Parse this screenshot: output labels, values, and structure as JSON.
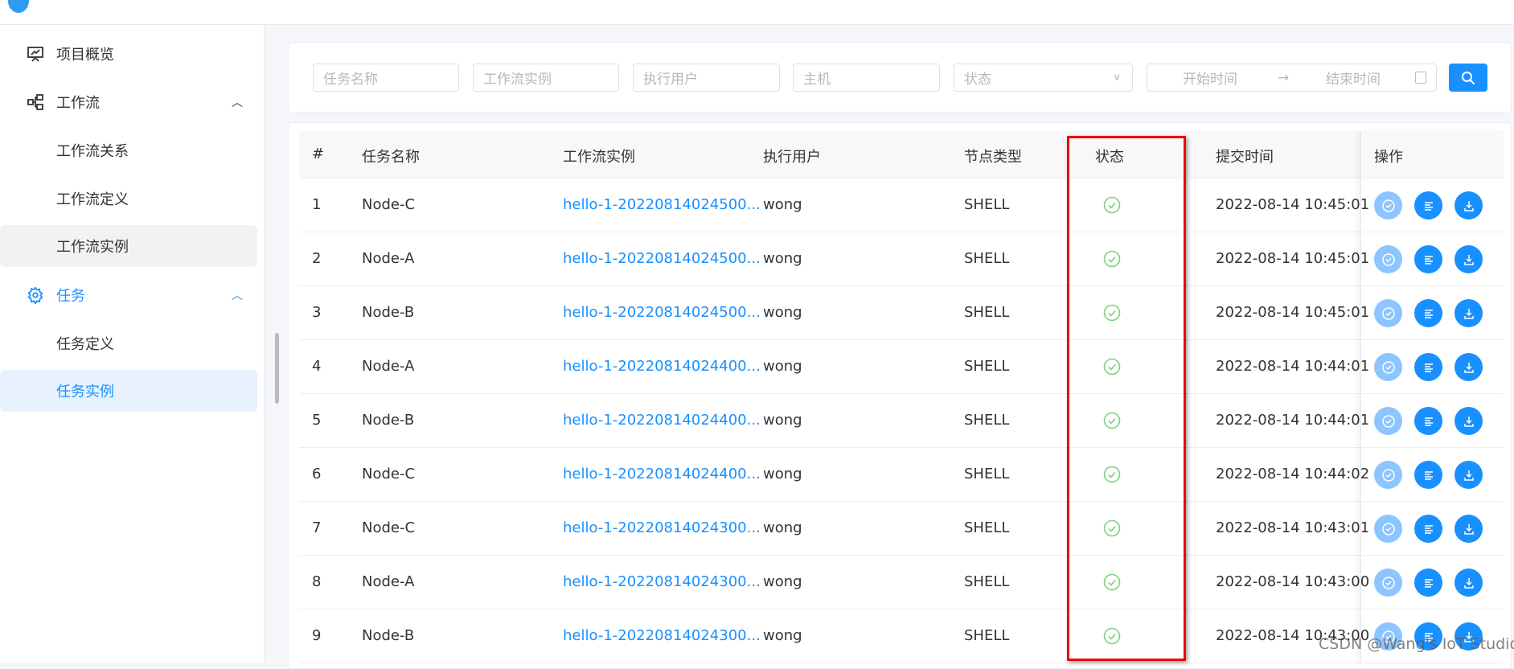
{
  "sidebar": {
    "items": [
      {
        "label": "项目概览",
        "icon": "presentation-chart-icon"
      },
      {
        "label": "工作流",
        "icon": "workflow-icon",
        "expanded": true
      },
      {
        "label": "工作流关系"
      },
      {
        "label": "工作流定义"
      },
      {
        "label": "工作流实例"
      },
      {
        "label": "任务",
        "icon": "gear-icon",
        "expanded": true
      },
      {
        "label": "任务定义"
      },
      {
        "label": "任务实例",
        "active": true
      }
    ]
  },
  "filters": {
    "task_name": "任务名称",
    "workflow_instance": "工作流实例",
    "executor": "执行用户",
    "host": "主机",
    "status": "状态",
    "start_time": "开始时间",
    "arrow": "→",
    "end_time": "结束时间"
  },
  "table": {
    "headers": [
      "#",
      "任务名称",
      "工作流实例",
      "执行用户",
      "节点类型",
      "状态",
      "提交时间",
      "操作"
    ],
    "rows": [
      [
        "1",
        "Node-C",
        "hello-1-20220814024500...",
        "wong",
        "SHELL",
        "success",
        "2022-08-14 10:45:01"
      ],
      [
        "2",
        "Node-A",
        "hello-1-20220814024500...",
        "wong",
        "SHELL",
        "success",
        "2022-08-14 10:45:01"
      ],
      [
        "3",
        "Node-B",
        "hello-1-20220814024500...",
        "wong",
        "SHELL",
        "success",
        "2022-08-14 10:45:01"
      ],
      [
        "4",
        "Node-A",
        "hello-1-20220814024400...",
        "wong",
        "SHELL",
        "success",
        "2022-08-14 10:44:01"
      ],
      [
        "5",
        "Node-B",
        "hello-1-20220814024400...",
        "wong",
        "SHELL",
        "success",
        "2022-08-14 10:44:01"
      ],
      [
        "6",
        "Node-C",
        "hello-1-20220814024400...",
        "wong",
        "SHELL",
        "success",
        "2022-08-14 10:44:02"
      ],
      [
        "7",
        "Node-C",
        "hello-1-20220814024300...",
        "wong",
        "SHELL",
        "success",
        "2022-08-14 10:43:01"
      ],
      [
        "8",
        "Node-A",
        "hello-1-20220814024300...",
        "wong",
        "SHELL",
        "success",
        "2022-08-14 10:43:00"
      ],
      [
        "9",
        "Node-B",
        "hello-1-20220814024300...",
        "wong",
        "SHELL",
        "success",
        "2022-08-14 10:43:00"
      ]
    ]
  },
  "colors": {
    "primary": "#1890ff",
    "success": "#7ed07e",
    "highlight": "#e00000"
  },
  "watermark": "CSDN @Wang's IoT Studio"
}
